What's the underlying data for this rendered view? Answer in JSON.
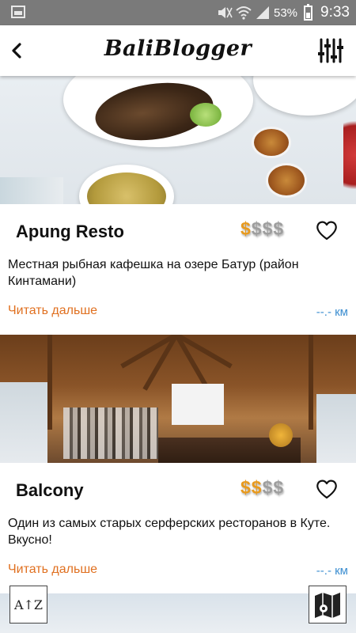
{
  "status_bar": {
    "battery": "53%",
    "time": "9:33"
  },
  "app_bar": {
    "back_icon": "chevron-left-icon",
    "title": "BaliBlogger",
    "filter_icon": "sliders-icon"
  },
  "restaurants": [
    {
      "name": "Apung Resto",
      "price_symbols": [
        "$",
        "$",
        "$",
        "$"
      ],
      "price_level": 1,
      "price_active_color": "#e89a1e",
      "price_inactive_color": "#9e9e9e",
      "description": "Местная рыбная кафешка на озере Батур (район Кинтамани)",
      "read_more": "Читать дальше",
      "distance": "--.- км"
    },
    {
      "name": "Balcony",
      "price_symbols": [
        "$",
        "$",
        "$",
        "$"
      ],
      "price_level": 2,
      "price_active_color": "#e89a1e",
      "price_inactive_color": "#9e9e9e",
      "description": "Один из самых старых серферских ресторанов в Куте. Вкусно!",
      "read_more": "Читать дальше",
      "distance": "--.- км"
    }
  ],
  "sort_button": {
    "label": "A↑Z"
  },
  "map_button": {
    "icon": "map-pin-icon"
  },
  "colors": {
    "accent_orange": "#e07020",
    "distance_blue": "#3e8fd1"
  }
}
